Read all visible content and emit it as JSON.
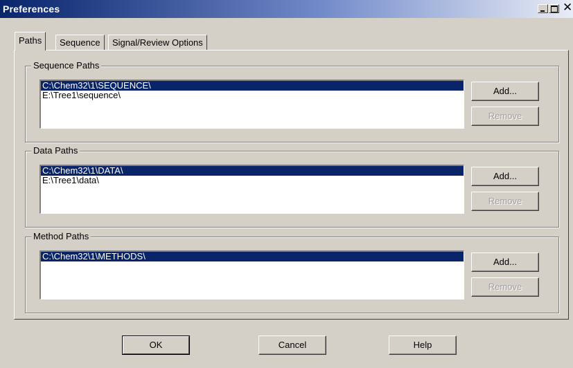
{
  "window": {
    "title": "Preferences"
  },
  "tabs": [
    {
      "label": "Paths",
      "active": true
    },
    {
      "label": "Sequence",
      "active": false
    },
    {
      "label": "Signal/Review Options",
      "active": false
    }
  ],
  "groups": {
    "sequence": {
      "legend": "Sequence Paths",
      "items": [
        "C:\\Chem32\\1\\SEQUENCE\\",
        "E:\\Tree1\\sequence\\"
      ],
      "add_label": "Add...",
      "remove_label": "Remove"
    },
    "data": {
      "legend": "Data Paths",
      "items": [
        "C:\\Chem32\\1\\DATA\\",
        "E:\\Tree1\\data\\"
      ],
      "add_label": "Add...",
      "remove_label": "Remove"
    },
    "method": {
      "legend": "Method Paths",
      "items": [
        "C:\\Chem32\\1\\METHODS\\"
      ],
      "add_label": "Add...",
      "remove_label": "Remove"
    }
  },
  "footer": {
    "ok_label": "OK",
    "cancel_label": "Cancel",
    "help_label": "Help"
  },
  "colors": {
    "selection": "#0a246a",
    "face": "#d4d0c8"
  }
}
